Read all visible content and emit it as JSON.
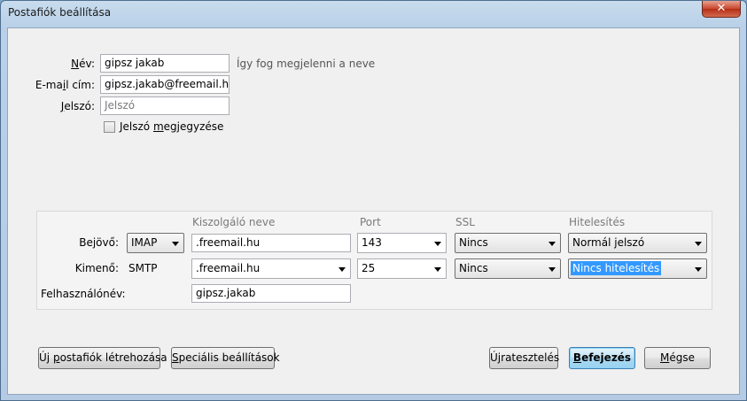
{
  "window": {
    "title": "Postafiók beállítása",
    "close_glyph": "✕"
  },
  "identity": {
    "name_label_pre": "",
    "name_label_u": "N",
    "name_label_post": "év:",
    "name_value": "gipsz jakab",
    "name_hint": "Így fog megjelenni a neve",
    "email_label_pre": "E-ma",
    "email_label_u": "i",
    "email_label_post": "l cím:",
    "email_value": "gipsz.jakab@freemail.hu",
    "password_label_pre": "",
    "password_label_u": "J",
    "password_label_post": "elszó:",
    "password_placeholder": "Jelszó",
    "remember_pre": "Jelszó ",
    "remember_u": "m",
    "remember_post": "egjegyzése"
  },
  "server": {
    "headers": {
      "hostname": "Kiszolgáló neve",
      "port": "Port",
      "ssl": "SSL",
      "auth": "Hitelesítés"
    },
    "incoming": {
      "label": "Bejövő:",
      "protocol": "IMAP",
      "hostname": ".freemail.hu",
      "port": "143",
      "ssl": "Nincs",
      "auth": "Normál jelszó"
    },
    "outgoing": {
      "label": "Kimenő:",
      "protocol": "SMTP",
      "hostname": ".freemail.hu",
      "port": "25",
      "ssl": "Nincs",
      "auth": "Nincs hitelesítés"
    },
    "username": {
      "label": "Felhasználónév:",
      "value": "gipsz.jakab"
    }
  },
  "buttons": {
    "new_account_pre": "Új ",
    "new_account_u": "p",
    "new_account_post": "ostafiók létrehozása",
    "advanced_pre": "",
    "advanced_u": "S",
    "advanced_post": "peciális beállítások",
    "retest_pre": "Ú",
    "retest_u": "j",
    "retest_post": "ratesztelés",
    "done_pre": "",
    "done_u": "B",
    "done_post": "efejezés",
    "cancel_pre": "",
    "cancel_u": "M",
    "cancel_post": "égse"
  }
}
